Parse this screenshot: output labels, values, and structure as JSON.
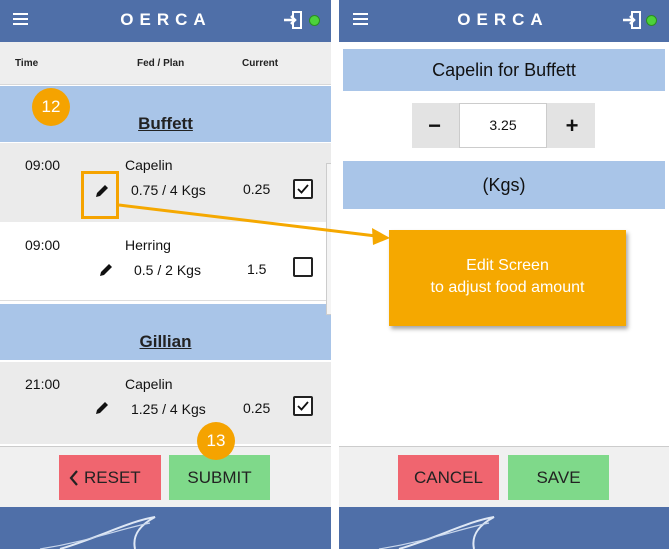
{
  "brand": "OERCA",
  "left": {
    "headers": {
      "time": "Time",
      "fed_plan": "Fed / Plan",
      "current": "Current"
    },
    "groups": [
      {
        "animal": "Buffett",
        "rows": [
          {
            "time": "09:00",
            "food": "Capelin",
            "fed": "0.75",
            "plan": "4",
            "unit": "Kgs",
            "current": "0.25",
            "checked": true
          },
          {
            "time": "09:00",
            "food": "Herring",
            "fed": "0.5",
            "plan": "2",
            "unit": "Kgs",
            "current": "1.5",
            "checked": false
          }
        ]
      },
      {
        "animal": "Gillian",
        "rows": [
          {
            "time": "21:00",
            "food": "Capelin",
            "fed": "1.25",
            "plan": "4",
            "unit": "Kgs",
            "current": "0.25",
            "checked": true
          }
        ]
      }
    ],
    "reset_label": "RESET",
    "submit_label": "SUBMIT"
  },
  "right": {
    "title": "Capelin for Buffett",
    "value": "3.25",
    "minus_label": "−",
    "plus_label": "+",
    "unit": "(Kgs)",
    "cancel_label": "CANCEL",
    "save_label": "SAVE"
  },
  "annotations": {
    "badge_a": "12",
    "badge_b": "13",
    "callout_line1": "Edit Screen",
    "callout_line2": "to adjust food amount"
  },
  "colors": {
    "topbar": "#4f6fa8",
    "group_header": "#a9c5e8",
    "reset": "#f0656f",
    "submit": "#7fd98a",
    "accent": "#f5a300",
    "status_dot": "#4cd23a"
  }
}
